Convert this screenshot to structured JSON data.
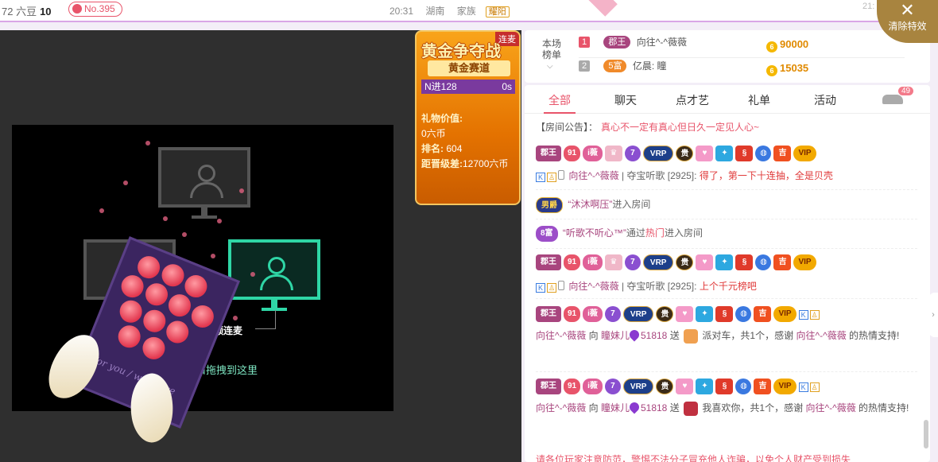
{
  "topbar": {
    "beans_label": "72 六豆",
    "level": "10",
    "rank": "No.395",
    "time": "20:31",
    "location": "湖南",
    "family_label": "家族",
    "family_tag": "耀阳",
    "time2": "21:"
  },
  "clear_effects": {
    "icon": "close-icon",
    "label": "清除特效"
  },
  "stage": {
    "multi_video_label": "多人视频连麦",
    "drag_hint": "连麦窗口拖拽到这里",
    "box_inscription": "For you / with love"
  },
  "gold_badge": {
    "title": "黄金争夺战",
    "corner_tag": "连麦",
    "ribbon": "黄金赛道",
    "progress_left": "N进128",
    "progress_right": "0s",
    "gift_value_label": "礼物价值:",
    "gift_value": "0六币",
    "rank_label": "排名:",
    "rank_value": "604",
    "promote_label": "距晋级差:",
    "promote_value": "12700六币"
  },
  "board": {
    "label": "本场榜单",
    "rows": [
      {
        "num": "1",
        "badge": "郡王",
        "name": "向往^-^薇薇",
        "coins": "90000"
      },
      {
        "num": "2",
        "badge": "5富",
        "name": "亿晨: 瞳",
        "coins": "15035"
      }
    ]
  },
  "tabs": {
    "items": [
      "全部",
      "聊天",
      "点才艺",
      "礼单",
      "活动"
    ],
    "car_count": "49"
  },
  "chat": {
    "notice_label": "【房间公告】：",
    "notice_text": "真心不一定有真心但日久一定见人心~",
    "badge_text": {
      "jw": "郡王",
      "n91": "91",
      "iw": "i薇",
      "seven": "7",
      "vrp": "VRP",
      "gui": "贵",
      "ji": "吉",
      "vip": "VIP",
      "nan": "男爵",
      "fu8": "8富"
    },
    "msg1": {
      "user": "向往^-^薇薇",
      "sep": "|",
      "activity": "夺宝听歌",
      "count": "[2925]:",
      "text": "得了，第一下十连抽，全是贝壳"
    },
    "entry1": {
      "quoted": "“沐沐啊压”",
      "text": "进入房间"
    },
    "entry2": {
      "quoted": "“听歌不听心™”",
      "mid": "通过",
      "hot": "热门",
      "text": "进入房间"
    },
    "msg2": {
      "user": "向往^-^薇薇",
      "sep": "|",
      "activity": "夺宝听歌",
      "count": "[2925]:",
      "text": "上个千元榜吧"
    },
    "gift1": {
      "from": "向往^-^薇薇",
      "to_word": "向",
      "to": "瞳妹儿",
      "num": "51818",
      "send": "送",
      "gift": "派对车，共1个，感谢",
      "thank_user": "向往^-^薇薇",
      "tail": "的热情支持!"
    },
    "gift2": {
      "from": "向往^-^薇薇",
      "to_word": "向",
      "to": "瞳妹儿",
      "num": "51818",
      "send": "送",
      "gift": "我喜欢你，共1个，感谢",
      "thank_user": "向往^-^薇薇",
      "tail": "的热情支持!"
    },
    "bottom_warning": "请各位玩家注意防范，警惕不法分子冒充他人诈骗，以免个人财产受到损失"
  },
  "colors": {
    "accent": "#e8546a",
    "gold": "#f9a41a",
    "purple": "#a8457e",
    "topbar_border": "#d9a6e6"
  }
}
